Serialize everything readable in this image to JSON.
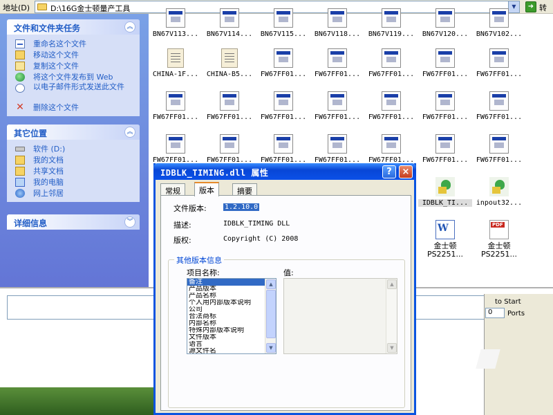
{
  "address_bar": {
    "label": "地址(D)",
    "path": "D:\\16G金士顿量产工具",
    "go_label": "转到"
  },
  "task_pane": {
    "file_tasks": {
      "title": "文件和文件夹任务",
      "items": [
        {
          "label": "重命名这个文件",
          "icon": "rename-icon"
        },
        {
          "label": "移动这个文件",
          "icon": "move-icon"
        },
        {
          "label": "复制这个文件",
          "icon": "copy-icon"
        },
        {
          "label": "将这个文件发布到 Web",
          "icon": "publish-web-icon"
        },
        {
          "label": "以电子邮件形式发送此文件",
          "icon": "email-icon"
        },
        {
          "label": "删除这个文件",
          "icon": "delete-icon"
        }
      ]
    },
    "other_places": {
      "title": "其它位置",
      "items": [
        {
          "label": "软件 (D:)",
          "icon": "drive-icon"
        },
        {
          "label": "我的文档",
          "icon": "my-documents-icon"
        },
        {
          "label": "共享文档",
          "icon": "shared-documents-icon"
        },
        {
          "label": "我的电脑",
          "icon": "my-computer-icon"
        },
        {
          "label": "网上邻居",
          "icon": "network-places-icon"
        }
      ]
    },
    "details": {
      "title": "详细信息"
    }
  },
  "files": [
    {
      "name": "BN67V113...",
      "type": "win"
    },
    {
      "name": "BN67V114...",
      "type": "win"
    },
    {
      "name": "BN67V115...",
      "type": "win"
    },
    {
      "name": "BN67V118...",
      "type": "win"
    },
    {
      "name": "BN67V119...",
      "type": "win"
    },
    {
      "name": "BN67V120...",
      "type": "win"
    },
    {
      "name": "BN67V102...",
      "type": "win"
    },
    {
      "name": "CHINA-1F...",
      "type": "txt"
    },
    {
      "name": "CHINA-B5...",
      "type": "txt"
    },
    {
      "name": "FW67FF01...",
      "type": "win"
    },
    {
      "name": "FW67FF01...",
      "type": "win"
    },
    {
      "name": "FW67FF01...",
      "type": "win"
    },
    {
      "name": "FW67FF01...",
      "type": "win"
    },
    {
      "name": "FW67FF01...",
      "type": "win"
    },
    {
      "name": "FW67FF01...",
      "type": "win"
    },
    {
      "name": "FW67FF01...",
      "type": "win"
    },
    {
      "name": "FW67FF01...",
      "type": "win"
    },
    {
      "name": "FW67FF01...",
      "type": "win"
    },
    {
      "name": "FW67FF01...",
      "type": "win"
    },
    {
      "name": "FW67FF01...",
      "type": "win"
    },
    {
      "name": "FW67FF01...",
      "type": "win"
    },
    {
      "name": "FW67FF01...",
      "type": "win"
    },
    {
      "name": "FW67FF01...",
      "type": "win"
    },
    {
      "name": "FW67FF01...",
      "type": "win"
    },
    {
      "name": "FW67FF01...",
      "type": "win"
    },
    {
      "name": "FW67FF01...",
      "type": "win"
    },
    {
      "name": "FW67FF01...",
      "type": "win"
    },
    {
      "name": "FW67FF01...",
      "type": "win"
    },
    {
      "name": "IDBLK_TI...",
      "type": "dll"
    },
    {
      "name": "inpout32...",
      "type": "dll"
    },
    {
      "name": "金士顿 PS2251...",
      "type": "doc"
    },
    {
      "name": "金士顿 PS2251...",
      "type": "pdf"
    }
  ],
  "background_window": {
    "auto_start_label": "to Start",
    "ports_value": "0",
    "ports_label": "Ports"
  },
  "dialog": {
    "title": "IDBLK_TIMING.dll 属性",
    "help_label": "?",
    "close_label": "×",
    "tabs": [
      "常规",
      "版本",
      "摘要"
    ],
    "active_tab": "版本",
    "file_version_label": "文件版本:",
    "file_version_value": "1.2.10.0",
    "description_label": "描述:",
    "description_value": "IDBLK_TIMING DLL",
    "copyright_label": "版权:",
    "copyright_value": "Copyright (C) 2008",
    "other_info_title": "其他版本信息",
    "item_name_label": "项目名称:",
    "value_label": "值:",
    "items": [
      "备注",
      "产品版本",
      "产品名称",
      "个人用内部版本说明",
      "公司",
      "合法商标",
      "内部名称",
      "特殊内部版本说明",
      "文件版本",
      "语言",
      "源文件名"
    ],
    "selected_item": "备注"
  },
  "colors": {
    "title_bar": "#0a50e8",
    "task_pane": "#6375d6",
    "link": "#215dc6",
    "selection": "#316ac5",
    "tab_highlight": "#e68b2c"
  }
}
